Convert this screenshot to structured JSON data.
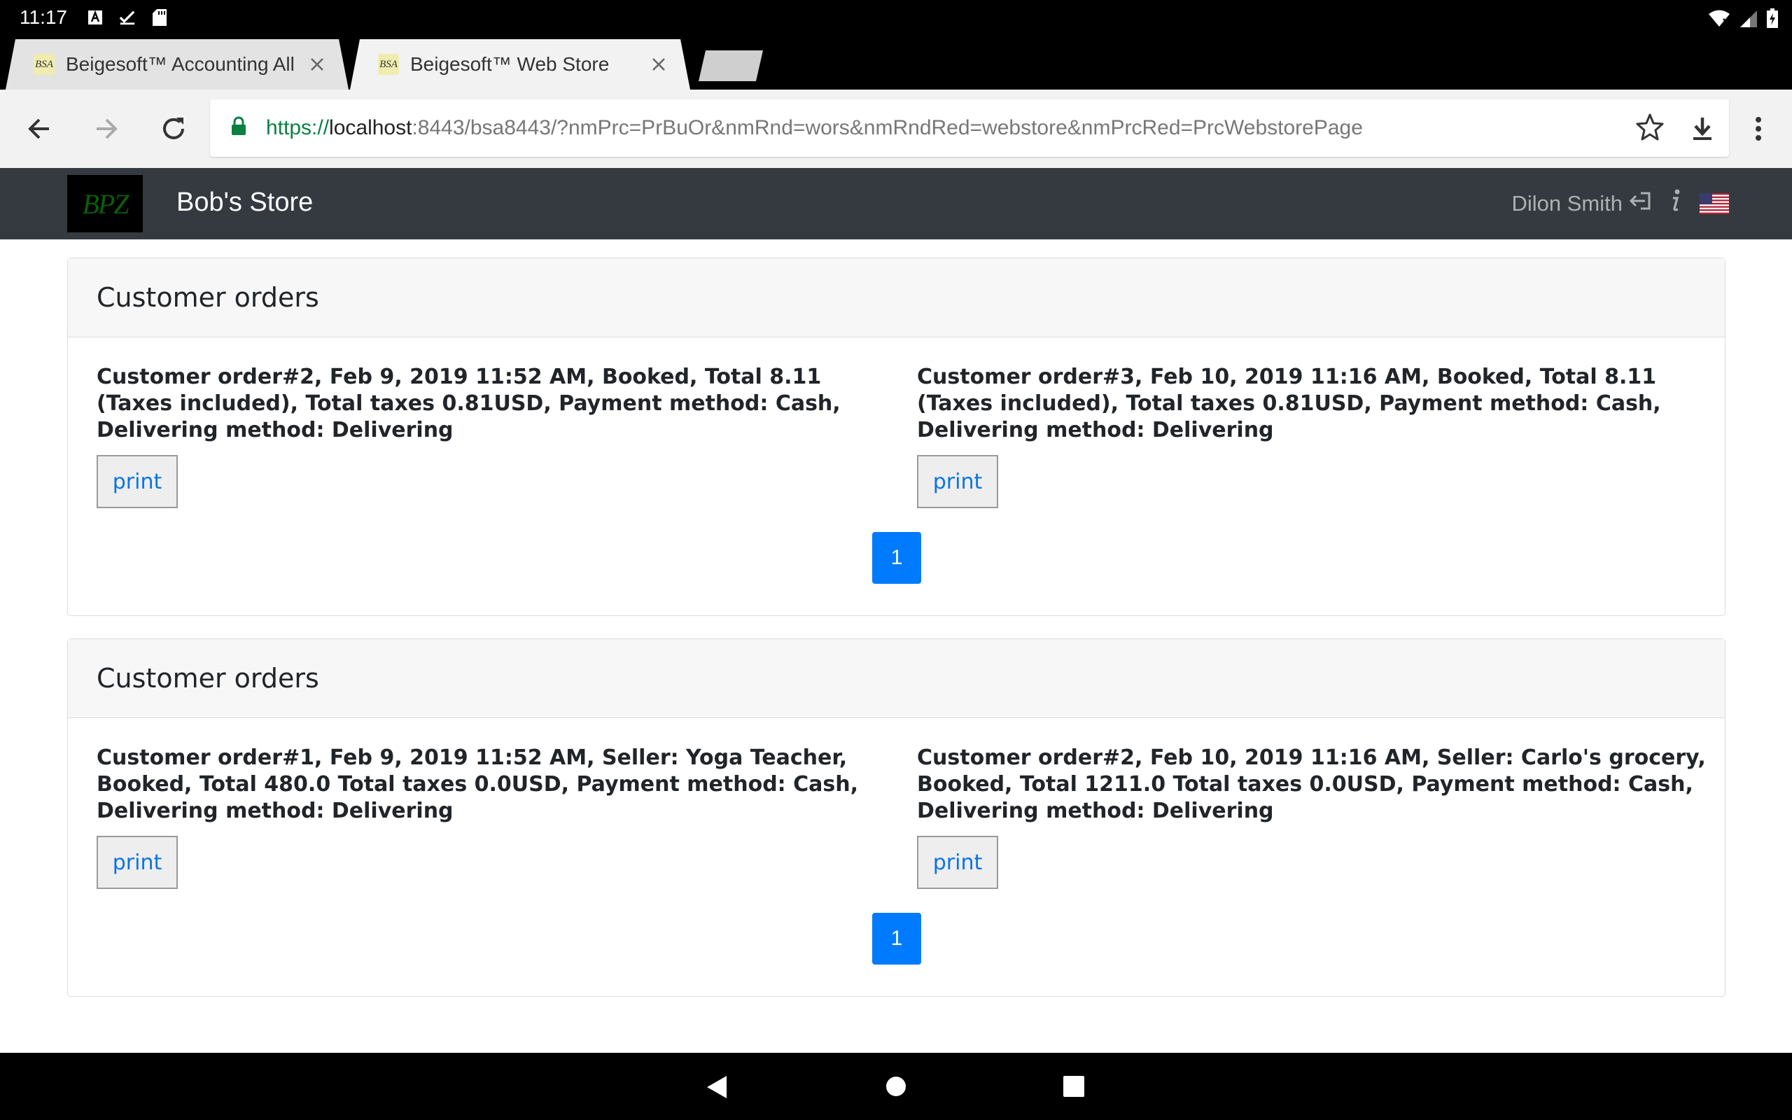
{
  "status_bar": {
    "time": "11:17"
  },
  "tabs": [
    {
      "favicon": "BSA",
      "title": "Beigesoft™ Accounting All In",
      "active": false
    },
    {
      "favicon": "BSA",
      "title": "Beigesoft™ Web Store",
      "active": true
    }
  ],
  "omnibox": {
    "scheme": "https://",
    "host": "localhost",
    "rest": ":8443/bsa8443/?nmPrc=PrBuOr&nmRnd=wors&nmRndRed=webstore&nmPrcRed=PrcWebstorePage"
  },
  "navbar": {
    "logo_text": "BPZ",
    "brand": "Bob's Store",
    "user": "Dilon Smith"
  },
  "sections": [
    {
      "title": "Customer orders",
      "orders": [
        {
          "text": "Customer order#2, Feb 9, 2019 11:52 AM, Booked, Total 8.11 (Taxes included), Total taxes 0.81USD, Payment method: Cash, Delivering method: Delivering",
          "button": "print"
        },
        {
          "text": "Customer order#3, Feb 10, 2019 11:16 AM, Booked, Total 8.11 (Taxes included), Total taxes 0.81USD, Payment method: Cash, Delivering method: Delivering",
          "button": "print"
        }
      ],
      "page": "1"
    },
    {
      "title": "Customer orders",
      "orders": [
        {
          "text": "Customer order#1, Feb 9, 2019 11:52 AM, Seller: Yoga Teacher, Booked, Total 480.0 Total taxes 0.0USD, Payment method: Cash, Delivering method: Delivering",
          "button": "print"
        },
        {
          "text": "Customer order#2, Feb 10, 2019 11:16 AM, Seller: Carlo's grocery, Booked, Total 1211.0 Total taxes 0.0USD, Payment method: Cash, Delivering method: Delivering",
          "button": "print"
        }
      ],
      "page": "1"
    }
  ],
  "icons": {
    "status": [
      "a-icon",
      "check-icon",
      "sd-card-icon",
      "wifi-icon",
      "signal-icon",
      "battery-icon"
    ],
    "toolbar": [
      "back-icon",
      "forward-icon",
      "reload-icon",
      "lock-icon",
      "star-icon",
      "download-icon",
      "menu-icon"
    ],
    "navbar": [
      "logout-icon",
      "info-icon",
      "us-flag-icon"
    ],
    "system_nav": [
      "back-triangle-icon",
      "home-circle-icon",
      "recents-square-icon"
    ]
  },
  "colors": {
    "navbar_bg": "#343a40",
    "pager_bg": "#007bff",
    "link": "#0a73e6",
    "secure": "#0b8043"
  }
}
